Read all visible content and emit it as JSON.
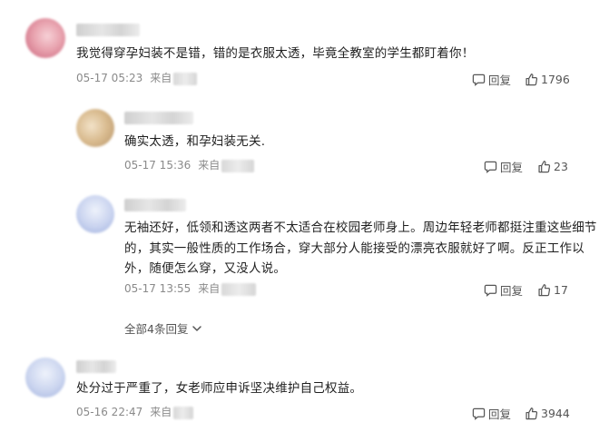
{
  "comments": [
    {
      "text": "我觉得穿孕妇装不是错，错的是衣服太透，毕竟全教室的学生都盯着你！",
      "time": "05-17 05:23",
      "source_prefix": "来自",
      "reply_label": "回复",
      "likes": "1796"
    },
    {
      "text": "确实太透，和孕妇装无关.",
      "time": "05-17 15:36",
      "source_prefix": "来自",
      "reply_label": "回复",
      "likes": "23"
    },
    {
      "text_lines": [
        "无袖还好，低领和透这两者不太适合在校园老师身上。周边年轻老师都挺注重这些细节",
        "的，其实一般性质的工作场合，穿大部分人能接受的漂亮衣服就好了啊。反正工作以",
        "外，随便怎么穿，又没人说。"
      ],
      "time": "05-17 13:55",
      "source_prefix": "来自",
      "reply_label": "回复",
      "likes": "17"
    },
    {
      "text": "处分过于严重了，女老师应申诉坚决维护自己权益。",
      "time": "05-16 22:47",
      "source_prefix": "来自",
      "reply_label": "回复",
      "likes": "3944"
    }
  ],
  "replies_toggle": "全部4条回复",
  "icons": [
    "comment-bubble-icon",
    "thumbs-up-icon",
    "chevron-down-icon"
  ]
}
